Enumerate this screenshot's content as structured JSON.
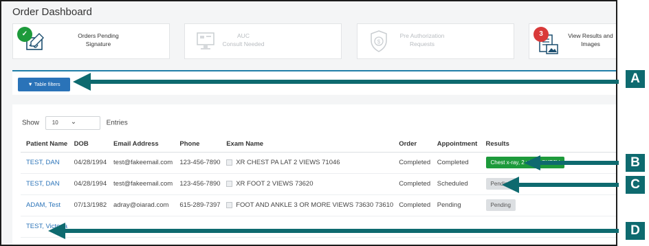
{
  "page_title": "Order Dashboard",
  "cards": [
    {
      "label_line1": "Orders Pending",
      "label_line2": "Signature",
      "badge": "",
      "icon": "signature-check-icon",
      "enabled": true
    },
    {
      "label_line1": "AUC",
      "label_line2": "Consult Needed",
      "badge": "",
      "icon": "monitor-icon",
      "enabled": false
    },
    {
      "label_line1": "Pre Authorization",
      "label_line2": "Requests",
      "badge": "",
      "icon": "shield-dollar-icon",
      "enabled": false
    },
    {
      "label_line1": "View Results and",
      "label_line2": "Images",
      "badge": "3",
      "icon": "results-images-icon",
      "enabled": true
    }
  ],
  "filters": {
    "button_label": "Table filters",
    "icon": "filter-icon"
  },
  "entries": {
    "show_label": "Show",
    "value": "10",
    "entries_label": "Entries"
  },
  "table": {
    "headers": [
      "Patient Name",
      "DOB",
      "Email Address",
      "Phone",
      "Exam Name",
      "Order",
      "Appointment",
      "Results"
    ],
    "rows": [
      {
        "name": "TEST, DAN",
        "dob": "04/28/1994",
        "email": "test@fakeemail.com",
        "phone": "123-456-7890",
        "exam": "XR CHEST PA LAT 2 VIEWS 71046",
        "order": "Completed",
        "appointment": "Completed",
        "result": "Chest x-ray, 2 views-CXR2V",
        "result_status": "done"
      },
      {
        "name": "TEST, DAN",
        "dob": "04/28/1994",
        "email": "test@fakeemail.com",
        "phone": "123-456-7890",
        "exam": "XR FOOT 2 VIEWS 73620",
        "order": "Completed",
        "appointment": "Scheduled",
        "result": "Pending",
        "result_status": "pend"
      },
      {
        "name": "ADAM, Test",
        "dob": "07/13/1982",
        "email": "adray@oiarad.com",
        "phone": "615-289-7397",
        "exam": "FOOT AND ANKLE 3 OR MORE VIEWS 73630 73610",
        "order": "Completed",
        "appointment": "Pending",
        "result": "Pending",
        "result_status": "pend"
      },
      {
        "name": "TEST, Victoria",
        "dob": "",
        "email": "",
        "phone": "",
        "exam": "",
        "order": "",
        "appointment": "",
        "result": "",
        "result_status": ""
      }
    ]
  },
  "callouts": [
    "A",
    "B",
    "C",
    "D"
  ],
  "colors": {
    "arrow": "#0e6a6f",
    "link": "#2a73b8",
    "success": "#1d9a3b",
    "badge_green": "#1d9a3b",
    "badge_red": "#d93a3a"
  }
}
